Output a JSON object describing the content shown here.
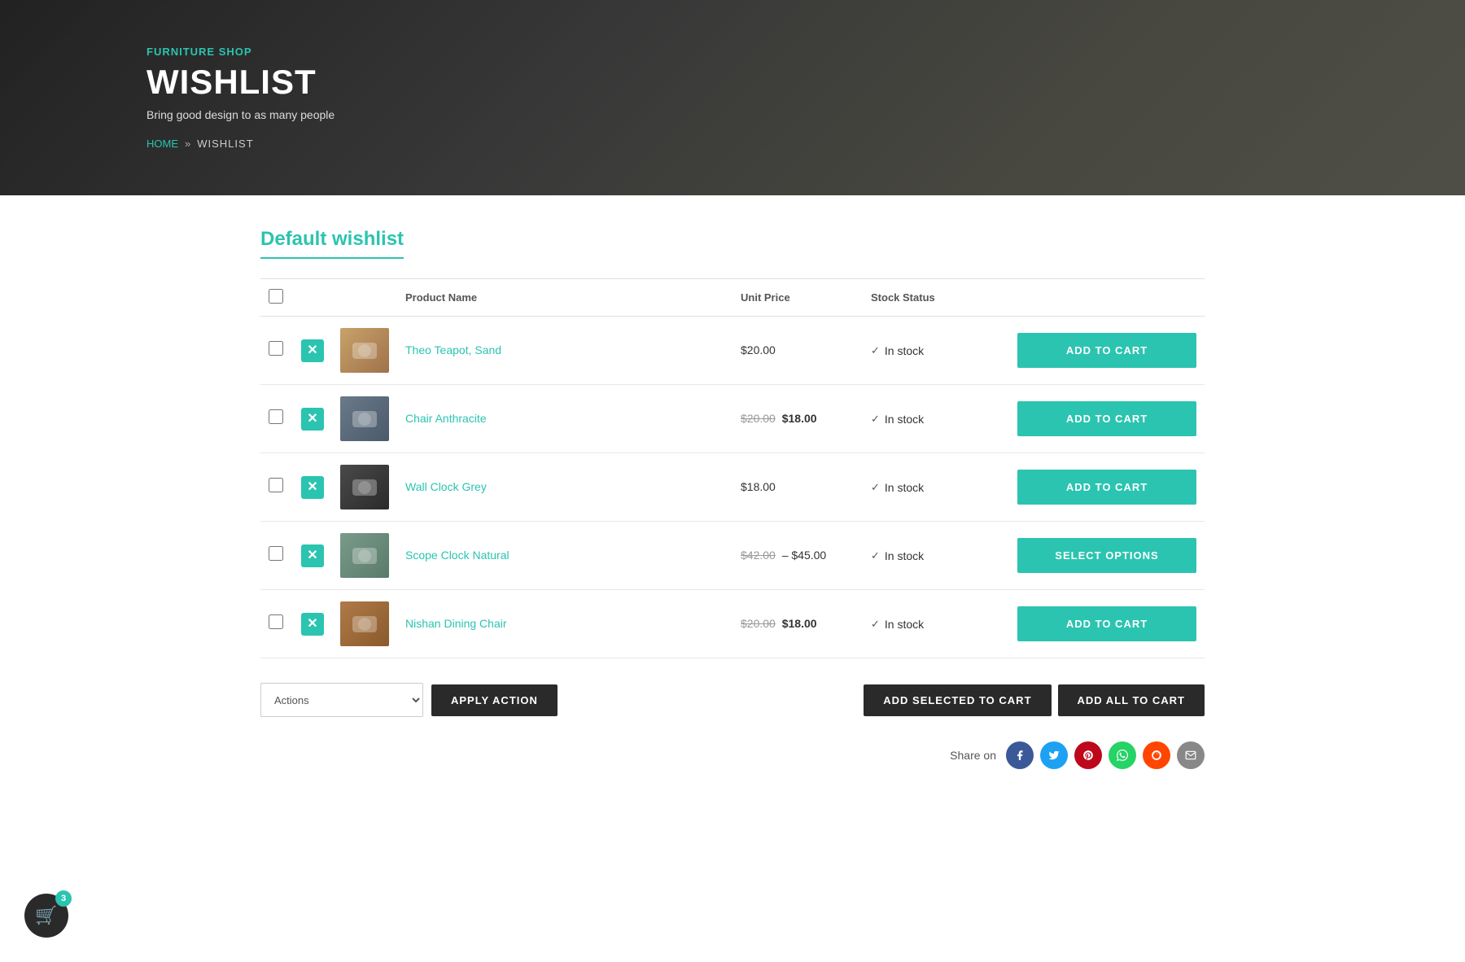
{
  "hero": {
    "shop_name": "FURNITURE SHOP",
    "title": "WISHLIST",
    "subtitle": "Bring good design to as many people",
    "breadcrumb_home": "HOME",
    "breadcrumb_sep": "»",
    "breadcrumb_current": "WISHLIST"
  },
  "wishlist": {
    "title": "Default wishlist",
    "columns": {
      "product_name": "Product Name",
      "unit_price": "Unit Price",
      "stock_status": "Stock Status"
    },
    "items": [
      {
        "id": 1,
        "name": "Theo Teapot, Sand",
        "price_display": "$20.00",
        "price_old": null,
        "price_new": null,
        "stock": "In stock",
        "action": "ADD TO CART",
        "action_type": "cart",
        "img_class": "img-teapot"
      },
      {
        "id": 2,
        "name": "Chair Anthracite",
        "price_display": null,
        "price_old": "$20.00",
        "price_new": "$18.00",
        "stock": "In stock",
        "action": "ADD TO CART",
        "action_type": "cart",
        "img_class": "img-chair"
      },
      {
        "id": 3,
        "name": "Wall Clock Grey",
        "price_display": "$18.00",
        "price_old": null,
        "price_new": null,
        "stock": "In stock",
        "action": "ADD TO CART",
        "action_type": "cart",
        "img_class": "img-clock"
      },
      {
        "id": 4,
        "name": "Scope Clock Natural",
        "price_display": null,
        "price_old": "$42.00",
        "price_new": "– $45.00",
        "stock": "In stock",
        "action": "SELECT OPTIONS",
        "action_type": "options",
        "img_class": "img-scope"
      },
      {
        "id": 5,
        "name": "Nishan Dining Chair",
        "price_display": null,
        "price_old": "$20.00",
        "price_new": "$18.00",
        "stock": "In stock",
        "action": "ADD TO CART",
        "action_type": "cart",
        "img_class": "img-dining"
      }
    ],
    "actions_placeholder": "Actions",
    "apply_action_label": "APPLY ACTION",
    "add_selected_label": "ADD SELECTED TO CART",
    "add_all_label": "ADD ALL TO CART"
  },
  "share": {
    "label": "Share on",
    "buttons": [
      {
        "name": "facebook",
        "icon": "f",
        "class": "share-fb"
      },
      {
        "name": "twitter",
        "icon": "t",
        "class": "share-tw"
      },
      {
        "name": "pinterest",
        "icon": "p",
        "class": "share-pi"
      },
      {
        "name": "whatsapp",
        "icon": "w",
        "class": "share-wa"
      },
      {
        "name": "reddit",
        "icon": "r",
        "class": "share-red"
      },
      {
        "name": "email",
        "icon": "✉",
        "class": "share-em"
      }
    ]
  },
  "cart": {
    "count": "3",
    "icon": "🛒"
  }
}
